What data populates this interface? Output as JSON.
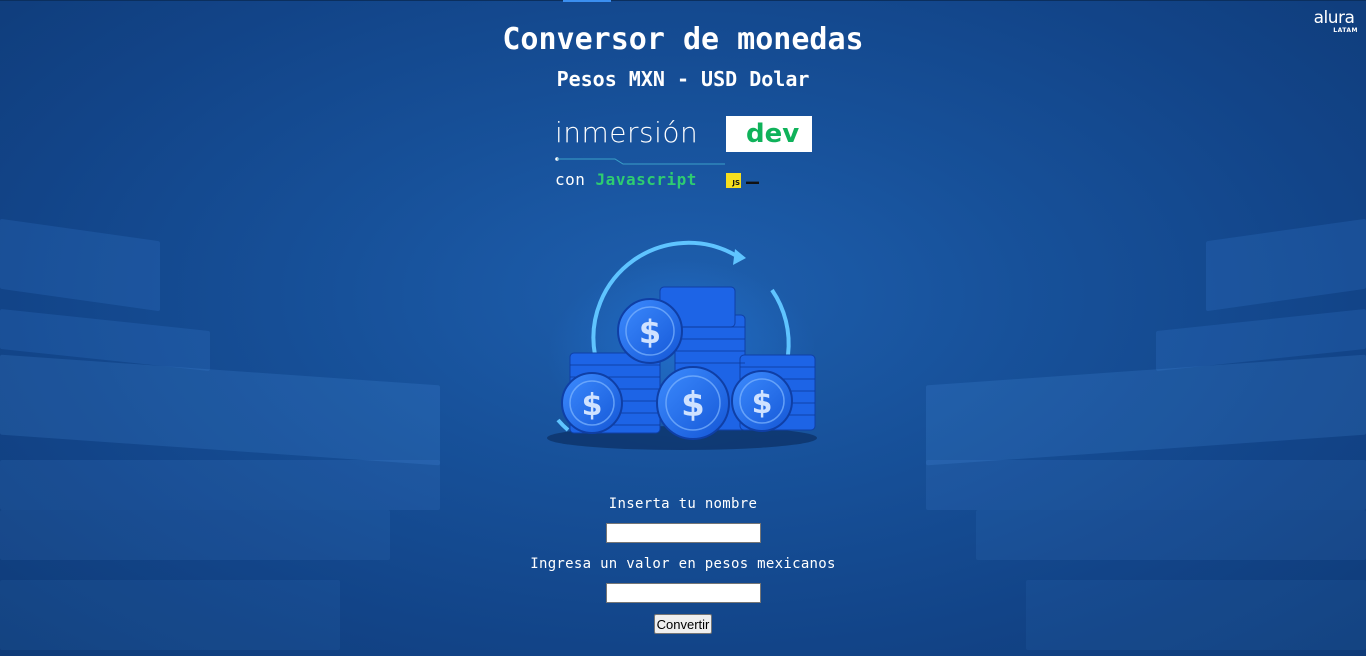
{
  "header": {
    "title": "Conversor de monedas",
    "subtitle": "Pesos MXN - USD Dolar"
  },
  "logo": {
    "name": "alura",
    "sub": "LATAM"
  },
  "brand": {
    "word": "inmersión",
    "dev": "dev",
    "cursor": "_",
    "con": "con",
    "language": "Javascript",
    "badge": "JS"
  },
  "illustration": {
    "icon": "coins-exchange-icon",
    "symbol": "$"
  },
  "form": {
    "name_label": "Inserta tu nombre",
    "name_value": "",
    "amount_label": "Ingresa un valor en pesos mexicanos",
    "amount_value": "",
    "submit_label": "Convertir"
  },
  "colors": {
    "background": "#17519a",
    "accent_green": "#0fb25a",
    "js_yellow": "#f7df1e",
    "coin_blue": "#1e6ff0"
  }
}
